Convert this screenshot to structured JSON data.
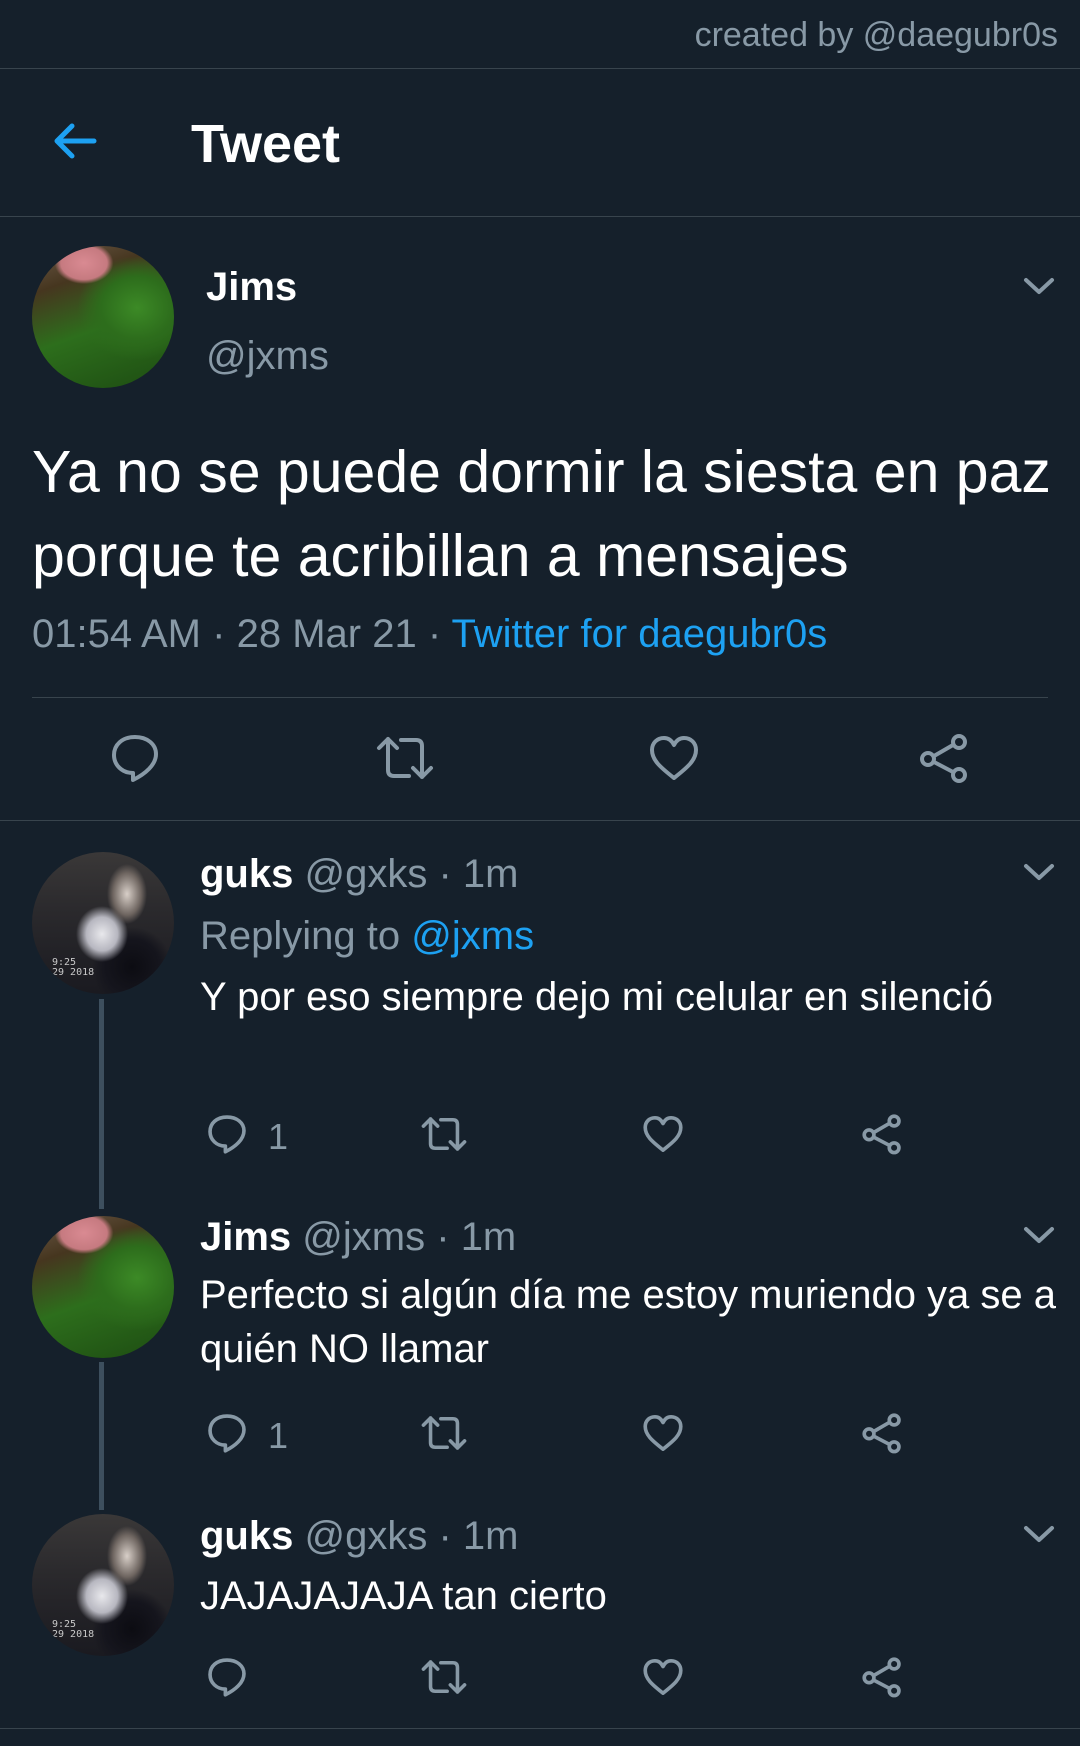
{
  "credit": "created by @daegubr0s",
  "header": {
    "title": "Tweet",
    "back_icon": "arrow-left-icon"
  },
  "colors": {
    "background": "#15202b",
    "accent": "#1da1f2",
    "muted": "#8899a6",
    "border": "#38444d"
  },
  "main_tweet": {
    "name": "Jims",
    "handle": "@jxms",
    "text": "Ya no se puede dormir la siesta en paz porque te acribillan a mensajes",
    "time": "01:54 AM",
    "date": "28 Mar 21",
    "separator": "·",
    "source": "Twitter for daegubr0s",
    "actions": [
      "reply-icon",
      "retweet-icon",
      "like-icon",
      "share-icon"
    ]
  },
  "replies": [
    {
      "name": "guks",
      "handle": "@gxks",
      "separator": "·",
      "time": "1m",
      "replying_label": "Replying to",
      "replying_to": "@jxms",
      "text": "Y por eso siempre dejo mi celular en silenció",
      "reply_count": "1",
      "avatar_stamp_line1": "9:25",
      "avatar_stamp_line2": "29 2018"
    },
    {
      "name": "Jims",
      "handle": "@jxms",
      "separator": "·",
      "time": "1m",
      "text": "Perfecto si algún día me estoy muriendo ya se a quién NO llamar",
      "reply_count": "1"
    },
    {
      "name": "guks",
      "handle": "@gxks",
      "separator": "·",
      "time": "1m",
      "text": "JAJAJAJAJA tan cierto",
      "reply_count": "",
      "avatar_stamp_line1": "9:25",
      "avatar_stamp_line2": "29 2018"
    }
  ]
}
